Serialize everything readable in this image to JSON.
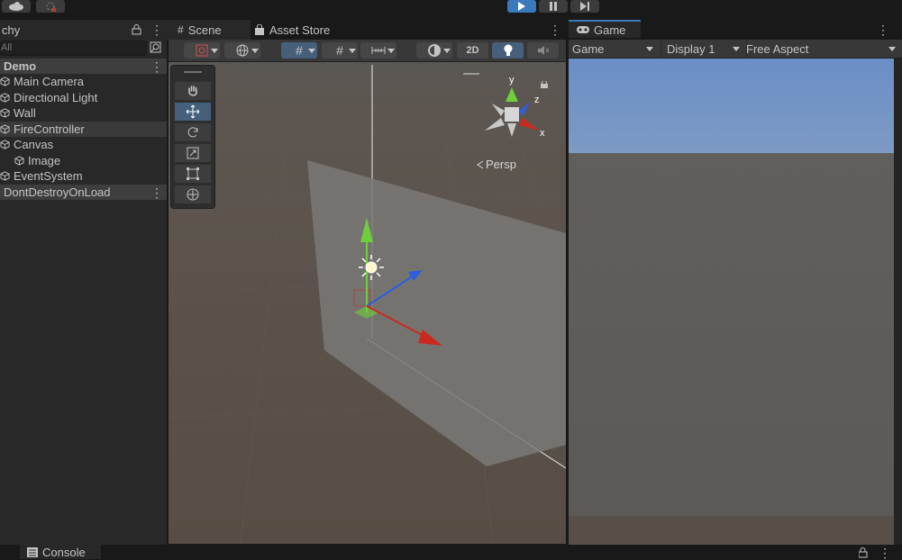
{
  "top_toolbar": {
    "cloud_icon": "cloud-icon",
    "collab_icon": "collab-icon",
    "play_icon": "play-icon",
    "pause_icon": "pause-icon",
    "step_icon": "step-icon"
  },
  "hierarchy": {
    "tab_label": "chy",
    "search_placeholder": "All",
    "scene_name": "Demo",
    "items": [
      {
        "label": "Main Camera"
      },
      {
        "label": "Directional Light"
      },
      {
        "label": "Wall"
      },
      {
        "label": "FireController"
      },
      {
        "label": "Canvas"
      },
      {
        "label": "Image"
      },
      {
        "label": "EventSystem"
      }
    ],
    "dont_destroy": "DontDestroyOnLoad"
  },
  "scene_panel": {
    "tab_scene": "Scene",
    "tab_asset_store": "Asset Store",
    "toggle_2d": "2D",
    "persp_label": "Persp",
    "gizmo_y": "y",
    "gizmo_x": "x",
    "gizmo_z": "z"
  },
  "game_panel": {
    "tab_label": "Game",
    "mode_select": "Game",
    "display_select": "Display 1",
    "aspect_select": "Free Aspect"
  },
  "bottom": {
    "console_tab": "Console"
  },
  "colors": {
    "accent_blue": "#46607c",
    "play_blue": "#3a79bb",
    "sky_blue": "#6e8fc0",
    "panel": "#282828",
    "axis_red": "#cc2a1e",
    "axis_green": "#6fcf3a",
    "axis_blue": "#2b5fe0"
  }
}
